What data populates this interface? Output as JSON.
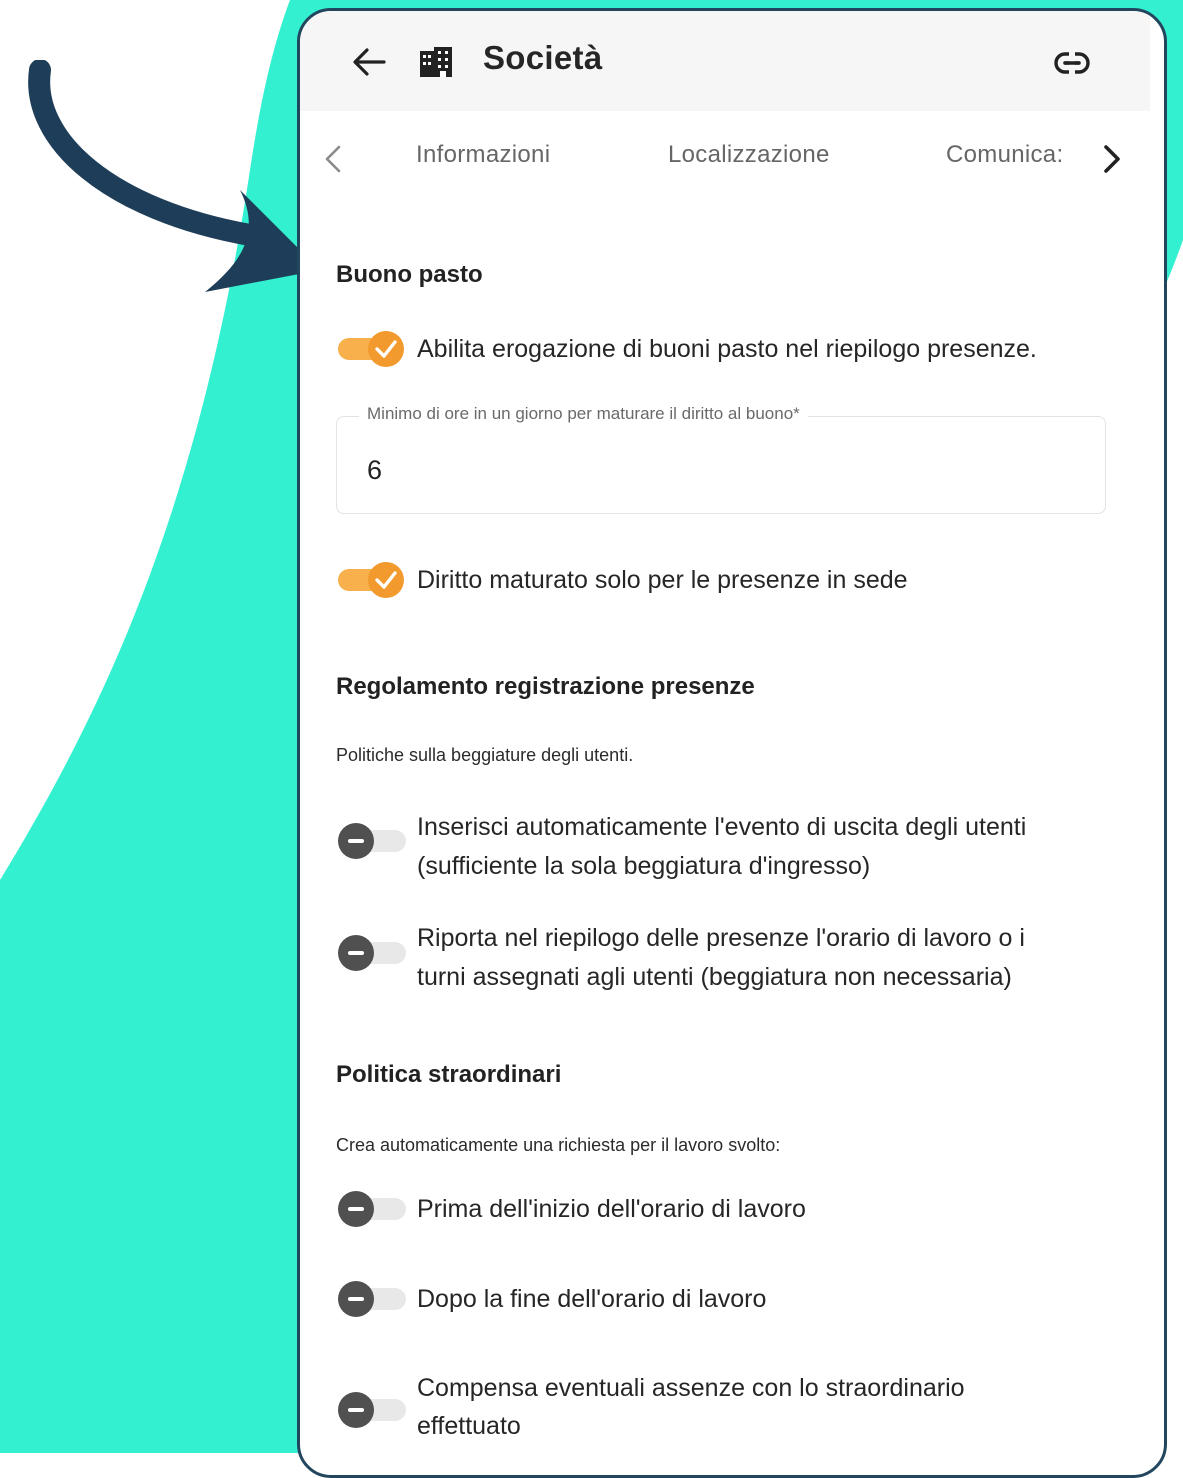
{
  "colors": {
    "background_accent": "#33f0d0",
    "frame_border": "#23465f",
    "arrow": "#1e3d58",
    "toggle_on": "#f39a2e",
    "toggle_off_knob": "#505050",
    "toggle_off_track": "#e8e8e8"
  },
  "appbar": {
    "back_icon": "arrow-left",
    "building_icon": "building",
    "title": "Società",
    "link_icon": "link"
  },
  "tabs": {
    "prev_icon": "chevron-left",
    "next_icon": "chevron-right",
    "items": [
      "Informazioni",
      "Localizzazione",
      "Comunica:"
    ]
  },
  "sections": {
    "buono_pasto": {
      "title": "Buono pasto",
      "toggle_enable": {
        "label": "Abilita erogazione di buoni pasto nel riepilogo presenze.",
        "on": true
      },
      "min_hours_field": {
        "label": "Minimo di ore in un giorno per maturare il diritto al buono*",
        "value": "6"
      },
      "toggle_sede": {
        "label": "Diritto maturato solo per le presenze in sede",
        "on": true
      }
    },
    "regolamento": {
      "title": "Regolamento registrazione presenze",
      "caption": "Politiche sulla beggiature degli utenti.",
      "toggle_uscita": {
        "label_line1": "Inserisci automaticamente l'evento di uscita degli utenti",
        "label_line2": "(sufficiente la sola beggiatura d'ingresso)",
        "on": false
      },
      "toggle_orario": {
        "label_line1": "Riporta nel riepilogo delle presenze l'orario di lavoro o i",
        "label_line2": "turni assegnati agli utenti (beggiatura non necessaria)",
        "on": false
      }
    },
    "straordinari": {
      "title": "Politica straordinari",
      "caption": "Crea automaticamente una richiesta per il lavoro svolto:",
      "toggle_prima": {
        "label": "Prima dell'inizio dell'orario di lavoro",
        "on": false
      },
      "toggle_dopo": {
        "label": "Dopo la fine dell'orario di lavoro",
        "on": false
      },
      "toggle_compensa": {
        "label_line1": "Compensa eventuali assenze con lo straordinario",
        "label_line2": "effettuato",
        "on": false
      }
    }
  }
}
